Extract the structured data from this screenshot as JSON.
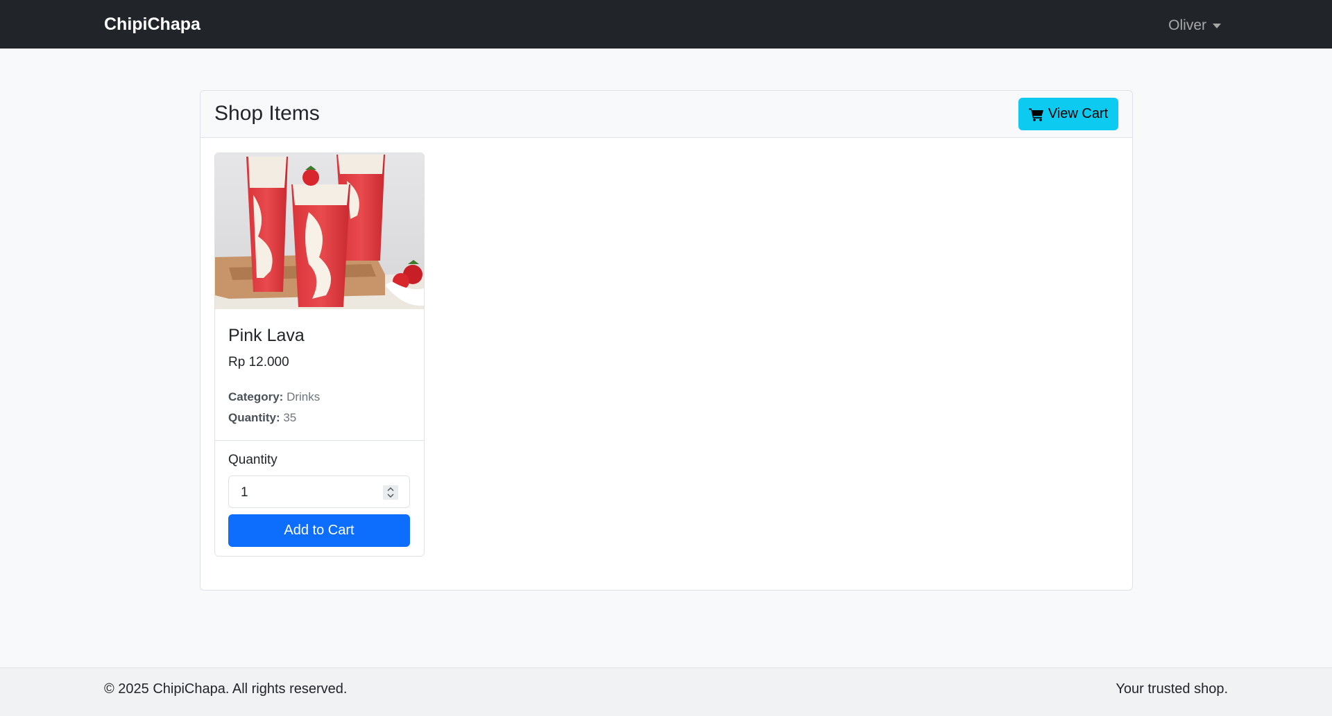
{
  "navbar": {
    "brand": "ChipiChapa",
    "user": "Oliver"
  },
  "shop": {
    "title": "Shop Items",
    "view_cart_label": "View Cart"
  },
  "product": {
    "name": "Pink Lava",
    "price": "Rp 12.000",
    "category_label": "Category:",
    "category": "Drinks",
    "quantity_label": "Quantity:",
    "quantity": "35",
    "image_alt": "strawberry-milk-drinks-photo"
  },
  "cart_form": {
    "quantity_label": "Quantity",
    "quantity_value": "1",
    "add_label": "Add to Cart"
  },
  "footer": {
    "copyright": "© 2025 ChipiChapa. All rights reserved.",
    "tagline": "Your trusted shop."
  },
  "colors": {
    "navbar_bg": "#212529",
    "info_button": "#0dcaf0",
    "primary_button": "#0d6efd"
  },
  "icons": {
    "cart": "cart-icon",
    "caret": "chevron-down-icon",
    "spinner": "number-spinner-icon"
  }
}
